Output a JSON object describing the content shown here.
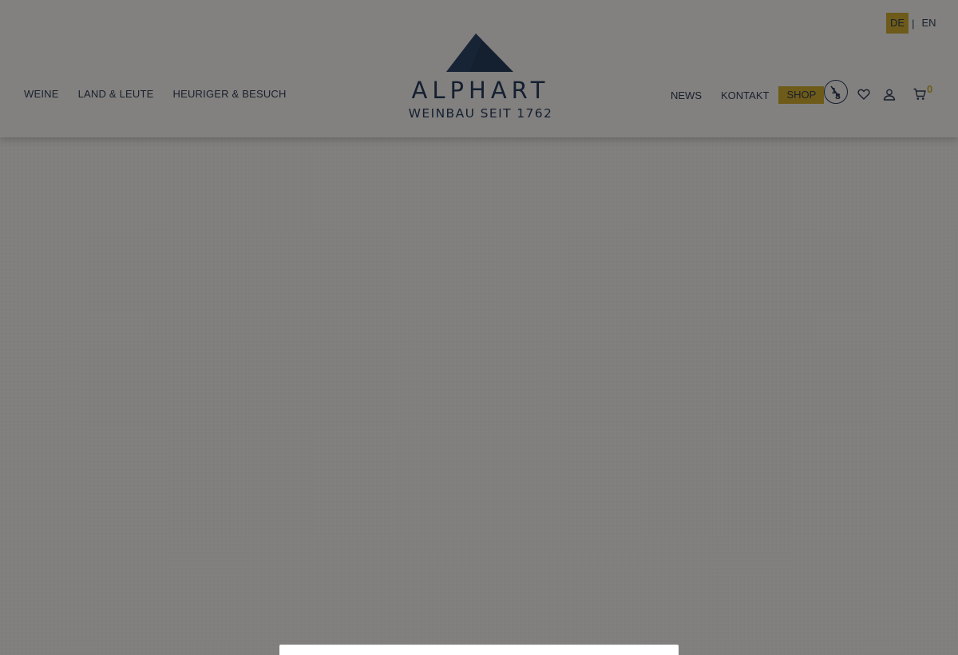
{
  "languages": {
    "active": "DE",
    "other": "EN",
    "separator": "|"
  },
  "nav_left": [
    {
      "label": "WEINE"
    },
    {
      "label": "LAND & LEUTE"
    },
    {
      "label": "HEURIGER & BESUCH"
    }
  ],
  "logo": {
    "name": "ALPHART",
    "subtitle": "WEINBAU SEIT 1762",
    "icon": "mountain-logo-icon"
  },
  "nav_right": {
    "news": "NEWS",
    "kontakt": "KONTAKT",
    "shop": "SHOP"
  },
  "icons": {
    "badge": "one-eighth-icon",
    "wishlist": "heart-icon",
    "account": "user-icon",
    "cart": "cart-icon"
  },
  "cart": {
    "count": "0"
  },
  "colors": {
    "brand_navy": "#142a4c",
    "accent_gold": "#c9a21f",
    "overlay": "rgba(20,20,20,0.5)"
  }
}
